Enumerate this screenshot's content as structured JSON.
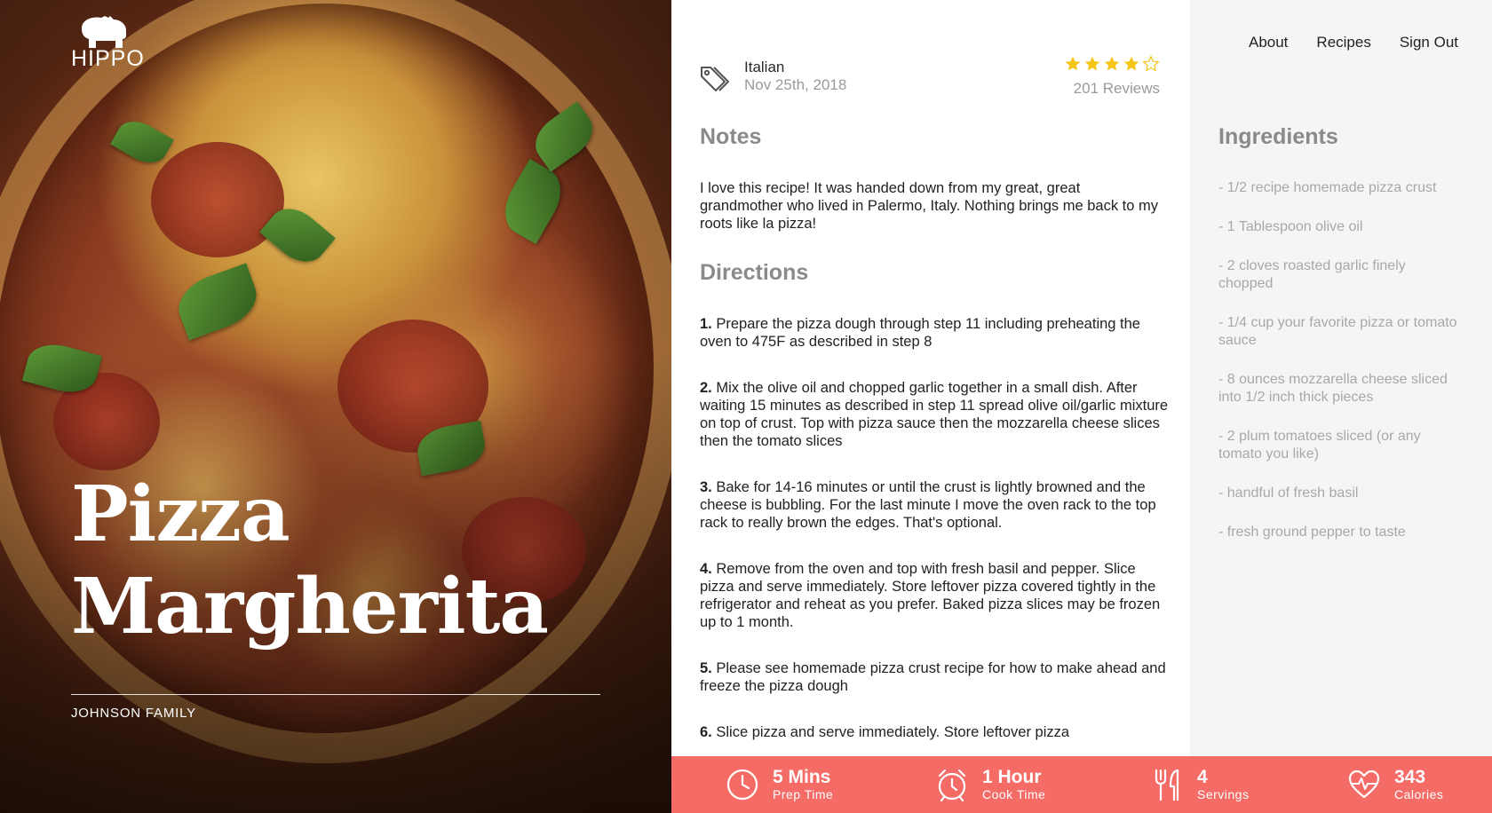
{
  "brand": {
    "name": "HIPPO"
  },
  "hero": {
    "title_line1": "Pizza",
    "title_line2": "Margherita",
    "author": "JOHNSON FAMILY"
  },
  "nav": {
    "about": "About",
    "recipes": "Recipes",
    "sign_out": "Sign Out"
  },
  "meta": {
    "category": "Italian",
    "date": "Nov 25th, 2018",
    "rating": 4,
    "rating_max": 5,
    "reviews": "201 Reviews",
    "star_color": "#f5c518"
  },
  "notes": {
    "heading": "Notes",
    "text": "I love this recipe! It was handed down from my great, great grandmother who lived in Palermo, Italy. Nothing brings me back to my roots like la pizza!"
  },
  "directions": {
    "heading": "Directions",
    "steps": [
      {
        "num": "1.",
        "text": "Prepare the pizza dough through step 11 including preheating the oven to 475F as described in step 8"
      },
      {
        "num": "2.",
        "text": "Mix the olive oil and chopped garlic together in a small dish. After waiting 15 minutes as described in step 11 spread olive oil/garlic mixture on top of crust. Top with pizza sauce then the mozzarella cheese slices then the tomato slices"
      },
      {
        "num": "3.",
        "text": "Bake for 14-16 minutes or until the crust is lightly browned and the cheese is bubbling. For the last minute I move the oven rack to the top rack to really brown the edges. That's optional."
      },
      {
        "num": "4.",
        "text": "Remove from the oven and top with fresh basil and pepper. Slice pizza and serve immediately. Store leftover pizza covered tightly in the refrigerator and reheat as you prefer. Baked pizza slices may be frozen up to 1 month."
      },
      {
        "num": "5.",
        "text": "Please see homemade pizza crust recipe for how to make ahead and freeze the pizza dough"
      },
      {
        "num": "6.",
        "text": "Slice pizza and serve immediately. Store leftover pizza"
      }
    ]
  },
  "ingredients": {
    "heading": "Ingredients",
    "items": [
      "- 1/2 recipe homemade pizza crust",
      "- 1 Tablespoon olive oil",
      "- 2 cloves roasted garlic finely chopped",
      "- 1/4 cup your favorite pizza or tomato sauce",
      "- 8 ounces mozzarella cheese sliced into 1/2 inch thick pieces",
      "- 2 plum tomatoes sliced (or any tomato you like)",
      "- handful of fresh basil",
      "- fresh ground pepper to taste"
    ]
  },
  "stats": {
    "bar_color": "#f56b66",
    "prep": {
      "value": "5 Mins",
      "label": "Prep Time",
      "icon": "clock-icon"
    },
    "cook": {
      "value": "1 Hour",
      "label": "Cook Time",
      "icon": "alarm-clock-icon"
    },
    "servings": {
      "value": "4",
      "label": "Servings",
      "icon": "fork-knife-icon"
    },
    "calories": {
      "value": "343",
      "label": "Calories",
      "icon": "heart-pulse-icon"
    }
  }
}
